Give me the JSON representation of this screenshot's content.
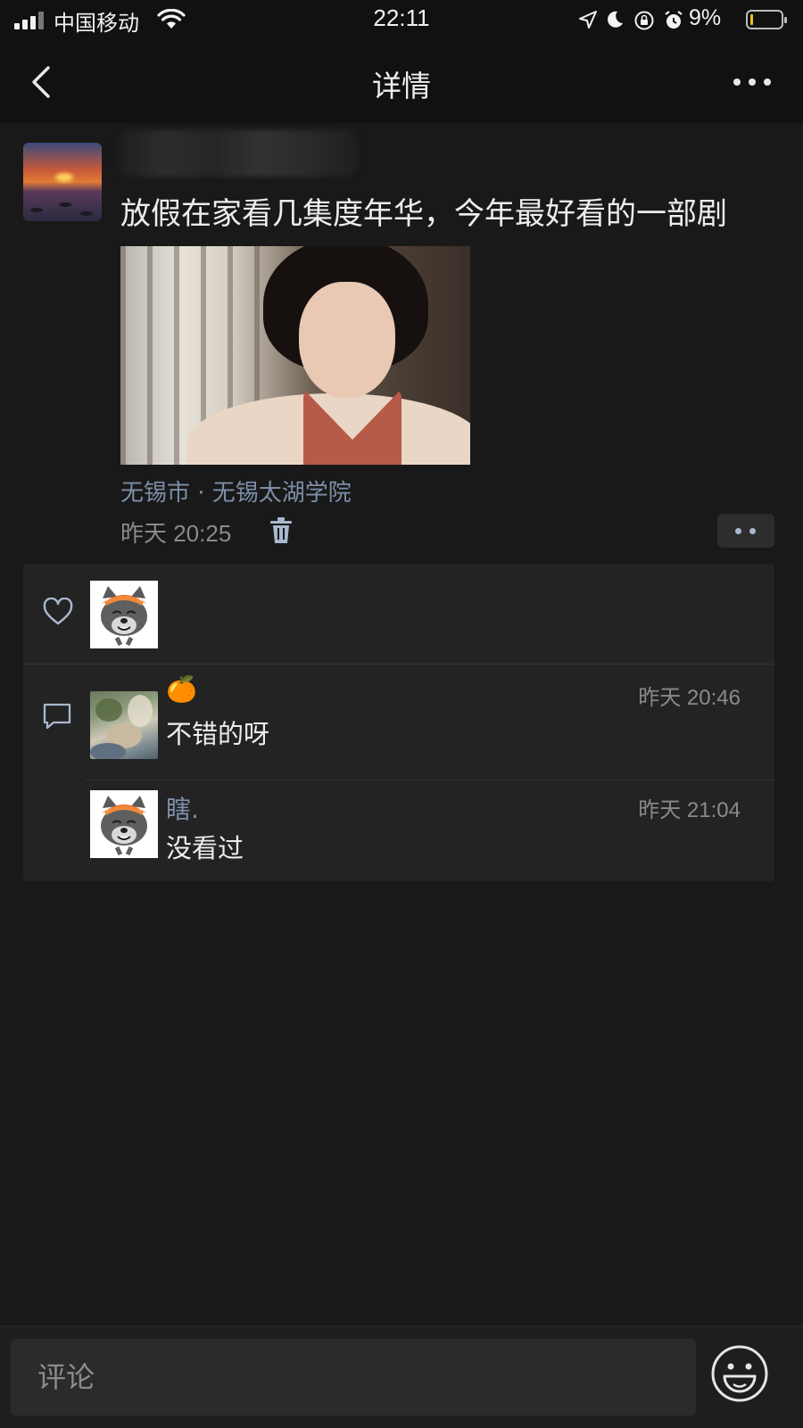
{
  "status_bar": {
    "carrier": "中国移动",
    "time": "22:11",
    "battery_percent": "9%",
    "battery_level": 0.09,
    "battery_color": "#f4c020",
    "icons": [
      "signal-icon",
      "wifi-icon",
      "location-icon",
      "moon-icon",
      "rotation-lock-icon",
      "alarm-icon",
      "battery-icon"
    ]
  },
  "nav": {
    "title": "详情",
    "back_icon": "chevron-left-icon",
    "more_icon": "ellipsis-icon"
  },
  "post": {
    "text": "放假在家看几集度年华，今年最好看的一部剧",
    "location": "无锡市 · 无锡太湖学院",
    "time": "昨天 20:25",
    "delete_icon": "trash-icon",
    "action_icon": "two-dots-icon"
  },
  "likes": {
    "icon": "heart-icon",
    "avatars": [
      "wolf-cartoon-avatar"
    ]
  },
  "comments": {
    "icon": "comment-icon",
    "items": [
      {
        "name": "🍊",
        "time": "昨天 20:46",
        "text": "不错的呀"
      },
      {
        "name": "瞎.",
        "time": "昨天 21:04",
        "text": "没看过"
      }
    ]
  },
  "input": {
    "placeholder": "评论",
    "emoji_icon": "smiley-icon"
  },
  "colors": {
    "background": "#191919",
    "bar": "#111111",
    "panel": "#232323",
    "link": "#7d8fa8",
    "muted": "#8a8a8a"
  }
}
